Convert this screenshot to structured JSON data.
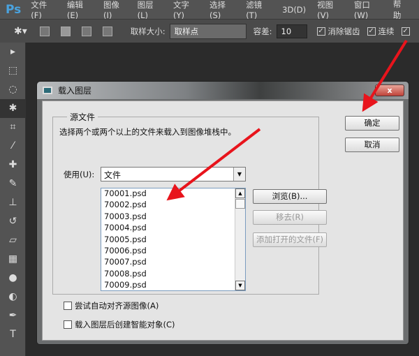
{
  "app": {
    "logo": "Ps",
    "menus": [
      "文件(F)",
      "编辑(E)",
      "图像(I)",
      "图层(L)",
      "文字(Y)",
      "选择(S)",
      "滤镜(T)",
      "3D(D)",
      "视图(V)",
      "窗口(W)",
      "帮助"
    ]
  },
  "options": {
    "sample_size_label": "取样大小:",
    "sample_size_value": "取样点",
    "tolerance_label": "容差:",
    "tolerance_value": "10",
    "antialias_label": "消除锯齿",
    "contiguous_label": "连续"
  },
  "dialog": {
    "title": "载入图层",
    "close": "x",
    "group_label": "源文件",
    "description": "选择两个或两个以上的文件来载入到图像堆栈中。",
    "use_label": "使用(U):",
    "use_value": "文件",
    "files": [
      "70001.psd",
      "70002.psd",
      "70003.psd",
      "70004.psd",
      "70005.psd",
      "70006.psd",
      "70007.psd",
      "70008.psd",
      "70009.psd"
    ],
    "browse": "浏览(B)...",
    "remove": "移去(R)",
    "add_open": "添加打开的文件(F)",
    "ok": "确定",
    "cancel": "取消",
    "auto_align": "尝试自动对齐源图像(A)",
    "smart_object": "载入图层后创建智能对象(C)"
  },
  "colors": {
    "arrow": "#e8141c"
  }
}
